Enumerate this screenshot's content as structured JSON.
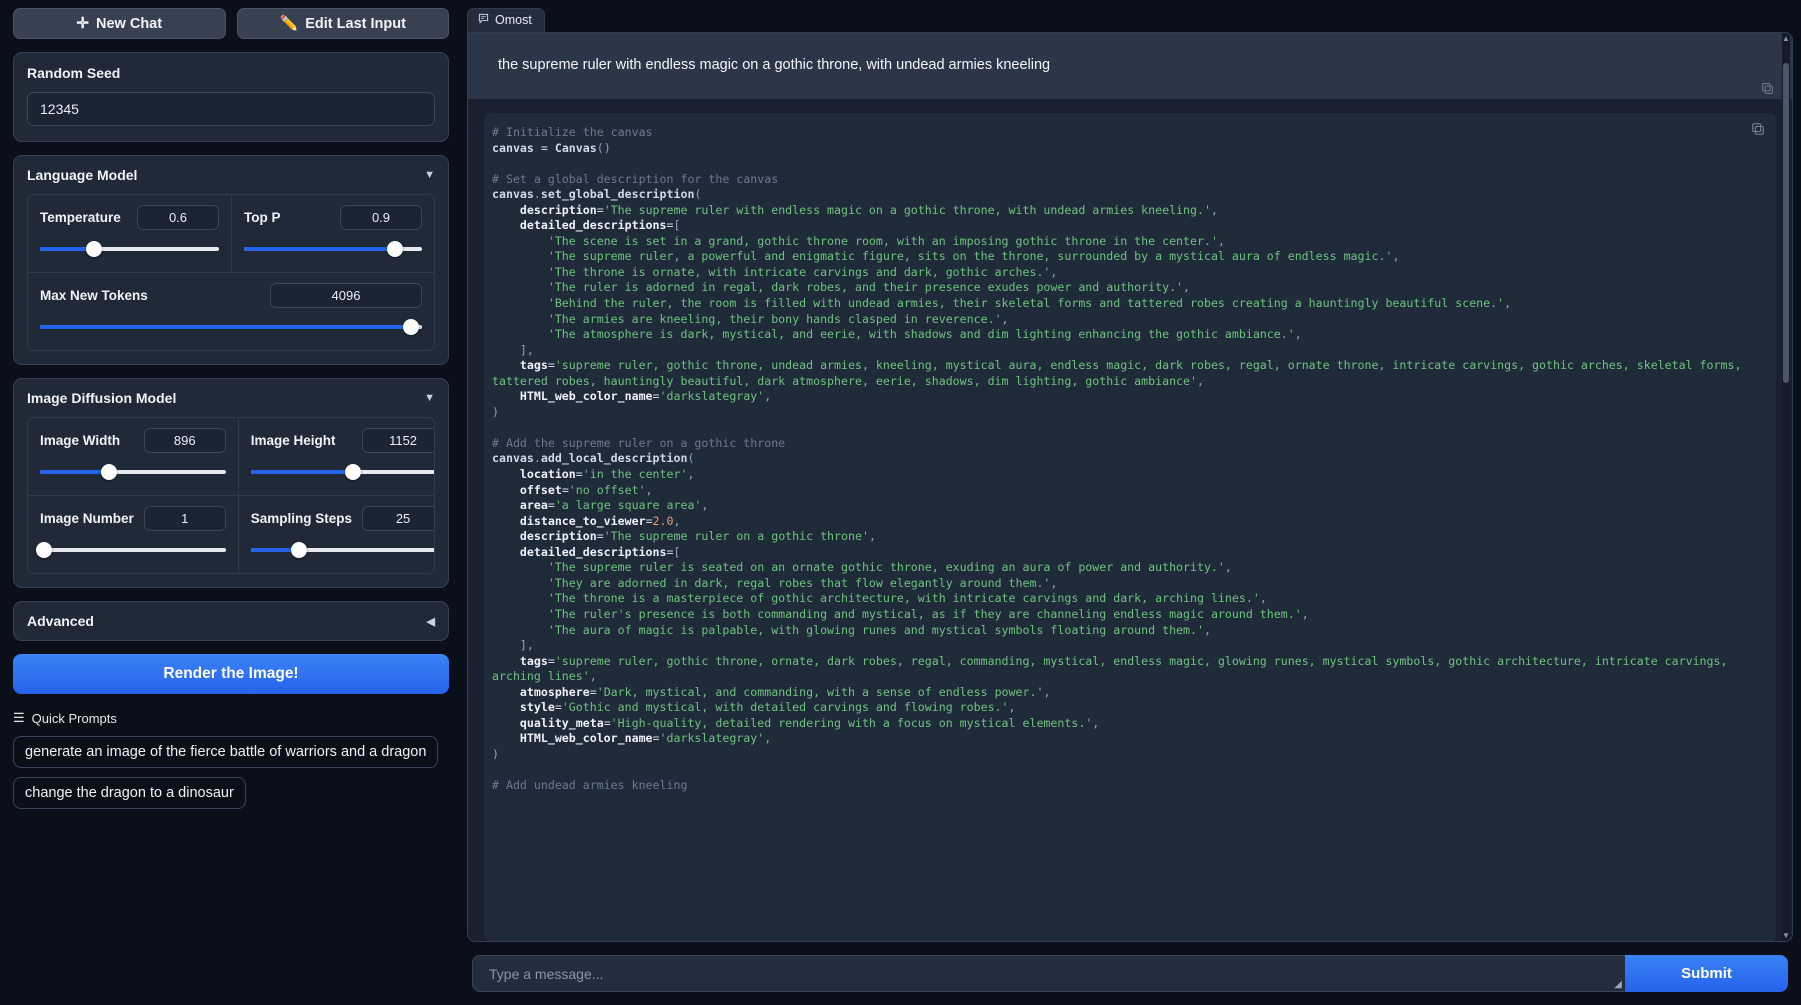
{
  "left": {
    "new_chat_label": "New Chat",
    "edit_last_input_label": "Edit Last Input",
    "seed": {
      "label": "Random Seed",
      "value": "12345"
    },
    "language_model": {
      "title": "Language Model",
      "temperature": {
        "label": "Temperature",
        "value": "0.6",
        "percent": 30
      },
      "top_p": {
        "label": "Top P",
        "value": "0.9",
        "percent": 85
      },
      "max_new_tokens": {
        "label": "Max New Tokens",
        "value": "4096",
        "percent": 97
      }
    },
    "image_diffusion_model": {
      "title": "Image Diffusion Model",
      "image_width": {
        "label": "Image Width",
        "value": "896",
        "percent": 37
      },
      "image_height": {
        "label": "Image Height",
        "value": "1152",
        "percent": 53
      },
      "image_number": {
        "label": "Image Number",
        "value": "1",
        "percent": 2
      },
      "sampling_steps": {
        "label": "Sampling Steps",
        "value": "25",
        "percent": 25
      }
    },
    "advanced": {
      "title": "Advanced"
    },
    "render_button": "Render the Image!",
    "quick_prompts": {
      "label": "Quick Prompts",
      "items": [
        "generate an image of the fierce battle of warriors and a dragon",
        "change the dragon to a dinosaur"
      ]
    }
  },
  "right": {
    "tab_label": "Omost",
    "user_message": "the supreme ruler with endless magic on a gothic throne, with undead armies kneeling",
    "message_placeholder": "Type a message...",
    "submit_label": "Submit",
    "code_lines": [
      [
        [
          "com",
          "# Initialize the canvas"
        ]
      ],
      [
        [
          "id",
          "canvas"
        ],
        [
          "op",
          " = "
        ],
        [
          "id",
          "Canvas"
        ],
        [
          "pun",
          "()"
        ]
      ],
      [],
      [
        [
          "com",
          "# Set a global description for the canvas"
        ]
      ],
      [
        [
          "id",
          "canvas"
        ],
        [
          "pun",
          "."
        ],
        [
          "id",
          "set_global_description"
        ],
        [
          "pun",
          "("
        ]
      ],
      [
        [
          "attr",
          "    description"
        ],
        [
          "op",
          "="
        ],
        [
          "str",
          "'The supreme ruler with endless magic on a gothic throne, with undead armies kneeling.'"
        ],
        [
          "pun",
          ","
        ]
      ],
      [
        [
          "attr",
          "    detailed_descriptions"
        ],
        [
          "op",
          "="
        ],
        [
          "pun",
          "["
        ]
      ],
      [
        [
          "str",
          "        'The scene is set in a grand, gothic throne room, with an imposing gothic throne in the center.'"
        ],
        [
          "pun",
          ","
        ]
      ],
      [
        [
          "str",
          "        'The supreme ruler, a powerful and enigmatic figure, sits on the throne, surrounded by a mystical aura of endless magic.'"
        ],
        [
          "pun",
          ","
        ]
      ],
      [
        [
          "str",
          "        'The throne is ornate, with intricate carvings and dark, gothic arches.'"
        ],
        [
          "pun",
          ","
        ]
      ],
      [
        [
          "str",
          "        'The ruler is adorned in regal, dark robes, and their presence exudes power and authority.'"
        ],
        [
          "pun",
          ","
        ]
      ],
      [
        [
          "str",
          "        'Behind the ruler, the room is filled with undead armies, their skeletal forms and tattered robes creating a hauntingly beautiful scene.'"
        ],
        [
          "pun",
          ","
        ]
      ],
      [
        [
          "str",
          "        'The armies are kneeling, their bony hands clasped in reverence.'"
        ],
        [
          "pun",
          ","
        ]
      ],
      [
        [
          "str",
          "        'The atmosphere is dark, mystical, and eerie, with shadows and dim lighting enhancing the gothic ambiance.'"
        ],
        [
          "pun",
          ","
        ]
      ],
      [
        [
          "pun",
          "    ],"
        ]
      ],
      [
        [
          "attr",
          "    tags"
        ],
        [
          "op",
          "="
        ],
        [
          "str",
          "'supreme ruler, gothic throne, undead armies, kneeling, mystical aura, endless magic, dark robes, regal, ornate throne, intricate carvings, gothic arches, skeletal forms, tattered robes, hauntingly beautiful, dark atmosphere, eerie, shadows, dim lighting, gothic ambiance'"
        ],
        [
          "pun",
          ","
        ]
      ],
      [
        [
          "attr",
          "    HTML_web_color_name"
        ],
        [
          "op",
          "="
        ],
        [
          "str",
          "'darkslategray'"
        ],
        [
          "pun",
          ","
        ]
      ],
      [
        [
          "pun",
          ")"
        ]
      ],
      [],
      [
        [
          "com",
          "# Add the supreme ruler on a gothic throne"
        ]
      ],
      [
        [
          "id",
          "canvas"
        ],
        [
          "pun",
          "."
        ],
        [
          "id",
          "add_local_description"
        ],
        [
          "pun",
          "("
        ]
      ],
      [
        [
          "attr",
          "    location"
        ],
        [
          "op",
          "="
        ],
        [
          "str",
          "'in the center'"
        ],
        [
          "pun",
          ","
        ]
      ],
      [
        [
          "attr",
          "    offset"
        ],
        [
          "op",
          "="
        ],
        [
          "str",
          "'no offset'"
        ],
        [
          "pun",
          ","
        ]
      ],
      [
        [
          "attr",
          "    area"
        ],
        [
          "op",
          "="
        ],
        [
          "str",
          "'a large square area'"
        ],
        [
          "pun",
          ","
        ]
      ],
      [
        [
          "attr",
          "    distance_to_viewer"
        ],
        [
          "op",
          "="
        ],
        [
          "num",
          "2.0"
        ],
        [
          "pun",
          ","
        ]
      ],
      [
        [
          "attr",
          "    description"
        ],
        [
          "op",
          "="
        ],
        [
          "str",
          "'The supreme ruler on a gothic throne'"
        ],
        [
          "pun",
          ","
        ]
      ],
      [
        [
          "attr",
          "    detailed_descriptions"
        ],
        [
          "op",
          "="
        ],
        [
          "pun",
          "["
        ]
      ],
      [
        [
          "str",
          "        'The supreme ruler is seated on an ornate gothic throne, exuding an aura of power and authority.'"
        ],
        [
          "pun",
          ","
        ]
      ],
      [
        [
          "str",
          "        'They are adorned in dark, regal robes that flow elegantly around them.'"
        ],
        [
          "pun",
          ","
        ]
      ],
      [
        [
          "str",
          "        'The throne is a masterpiece of gothic architecture, with intricate carvings and dark, arching lines.'"
        ],
        [
          "pun",
          ","
        ]
      ],
      [
        [
          "str",
          "        'The ruler's presence is both commanding and mystical, as if they are channeling endless magic around them.'"
        ],
        [
          "pun",
          ","
        ]
      ],
      [
        [
          "str",
          "        'The aura of magic is palpable, with glowing runes and mystical symbols floating around them.'"
        ],
        [
          "pun",
          ","
        ]
      ],
      [
        [
          "pun",
          "    ],"
        ]
      ],
      [
        [
          "attr",
          "    tags"
        ],
        [
          "op",
          "="
        ],
        [
          "str",
          "'supreme ruler, gothic throne, ornate, dark robes, regal, commanding, mystical, endless magic, glowing runes, mystical symbols, gothic architecture, intricate carvings, arching lines'"
        ],
        [
          "pun",
          ","
        ]
      ],
      [
        [
          "attr",
          "    atmosphere"
        ],
        [
          "op",
          "="
        ],
        [
          "str",
          "'Dark, mystical, and commanding, with a sense of endless power.'"
        ],
        [
          "pun",
          ","
        ]
      ],
      [
        [
          "attr",
          "    style"
        ],
        [
          "op",
          "="
        ],
        [
          "str",
          "'Gothic and mystical, with detailed carvings and flowing robes.'"
        ],
        [
          "pun",
          ","
        ]
      ],
      [
        [
          "attr",
          "    quality_meta"
        ],
        [
          "op",
          "="
        ],
        [
          "str",
          "'High-quality, detailed rendering with a focus on mystical elements.'"
        ],
        [
          "pun",
          ","
        ]
      ],
      [
        [
          "attr",
          "    HTML_web_color_name"
        ],
        [
          "op",
          "="
        ],
        [
          "str",
          "'darkslategray'"
        ],
        [
          "pun",
          ","
        ]
      ],
      [
        [
          "pun",
          ")"
        ]
      ],
      [],
      [
        [
          "com",
          "# Add undead armies kneeling"
        ]
      ]
    ]
  },
  "colors": {
    "accent": "#2563eb",
    "panel": "#1f2937",
    "background": "#0b0f19",
    "code_bg": "#202b3a",
    "string": "#6ec27e",
    "comment": "#6b7a8f"
  }
}
